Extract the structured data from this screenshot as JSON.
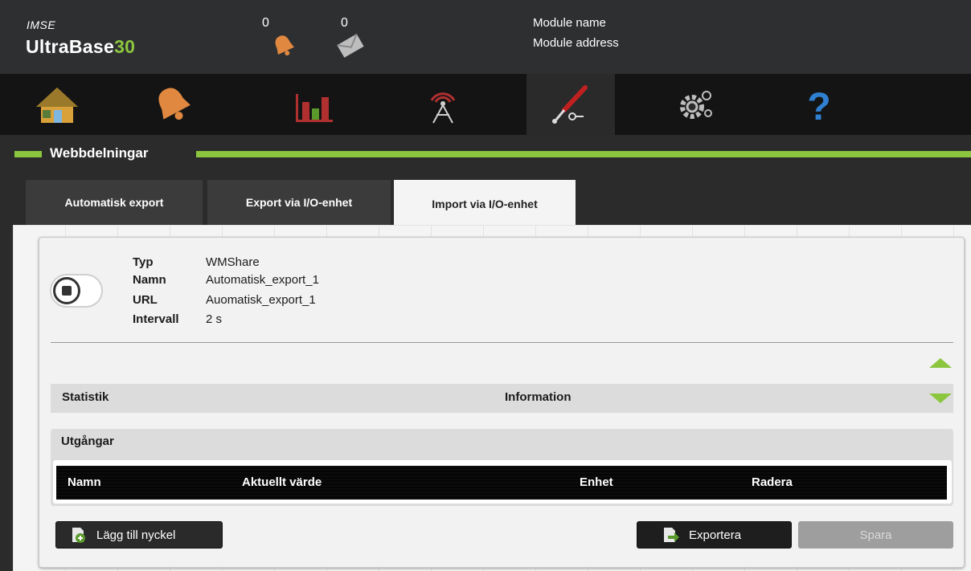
{
  "header": {
    "brand_small": "IMSE",
    "brand_main": "UltraBase",
    "brand_number": "30",
    "alarm_count": "0",
    "message_count": "0",
    "module_name": "Module name",
    "module_address": "Module address"
  },
  "nav": {
    "items": [
      "home-icon",
      "alarm-bell-icon",
      "bar-chart-icon",
      "antenna-icon",
      "tools-icon",
      "settings-gears-icon",
      "help-icon"
    ],
    "active": "tools-icon"
  },
  "section": {
    "title": "Webbdelningar"
  },
  "tabs": [
    {
      "label": "Automatisk export",
      "active": false
    },
    {
      "label": "Export via I/O-enhet",
      "active": false
    },
    {
      "label": "Import via I/O-enhet",
      "active": true
    }
  ],
  "share": {
    "type_label": "Typ",
    "type_value": "WMShare",
    "name_label": "Namn",
    "name_value": "Automatisk_export_1",
    "url_label": "URL",
    "url_value": "Auomatisk_export_1",
    "interval_label": "Intervall",
    "interval_value": "2 s"
  },
  "statistics": {
    "left": "Statistik",
    "center": "Information"
  },
  "outputs": {
    "title": "Utgångar",
    "columns": [
      "Namn",
      "Aktuellt värde",
      "Enhet",
      "Radera"
    ],
    "rows": []
  },
  "buttons": {
    "add_key": "Lägg till nyckel",
    "export": "Exportera",
    "save": "Spara"
  },
  "colors": {
    "accent": "#8cc63f",
    "header_bg": "#2e2f31",
    "nav_bg": "#141414"
  }
}
